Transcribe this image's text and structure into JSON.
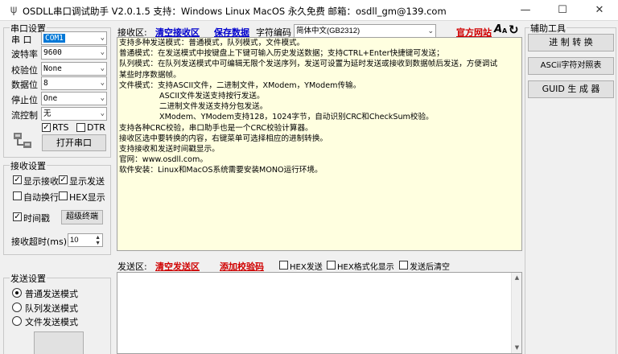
{
  "window": {
    "title": "OSDLL串口调试助手 V2.0.1.5 支持：Windows  Linux  MacOS   永久免费   邮箱：osdll_gm@139.com",
    "minimize": "—",
    "maximize": "☐",
    "close": "✕"
  },
  "serial_settings": {
    "title": "串口设置",
    "port_label": "串  口",
    "port_value": "COM1",
    "baud_label": "波特率",
    "baud_value": "9600",
    "parity_label": "校验位",
    "parity_value": "None",
    "databits_label": "数据位",
    "databits_value": "8",
    "stopbits_label": "停止位",
    "stopbits_value": "One",
    "flow_label": "流控制",
    "flow_value": "无",
    "rts_label": "RTS",
    "rts_checked": true,
    "dtr_label": "DTR",
    "dtr_checked": false,
    "open_button": "打开串口"
  },
  "receive_settings": {
    "title": "接收设置",
    "show_recv_label": "显示接收",
    "show_recv_checked": true,
    "show_send_label": "显示发送",
    "show_send_checked": true,
    "auto_wrap_label": "自动换行",
    "auto_wrap_checked": false,
    "hex_show_label": "HEX显示",
    "hex_show_checked": false,
    "timestamp_label": "时间戳",
    "timestamp_checked": true,
    "super_terminal_button": "超级终端",
    "timeout_label": "接收超时(ms):",
    "timeout_value": "10"
  },
  "send_settings": {
    "title": "发送设置",
    "mode_normal": "普通发送模式",
    "mode_queue": "队列发送模式",
    "mode_file": "文件发送模式",
    "selected": "normal"
  },
  "receive_area": {
    "label": "接收区:",
    "clear_link": "清空接收区",
    "save_link": "保存数据",
    "encoding_label": "字符编码",
    "encoding_value": "简体中文(GB2312)",
    "website_link": "官方网站",
    "lines": [
      "支持多种发送模式：普通模式，队列模式，文件模式。",
      "普通模式：在发送模式中按键盘上下键可输入历史发送数据；支持CTRL+Enter快捷键可发送；",
      "队列模式：在队列发送模式中可编辑无限个发送序列，发送可设置为延时发送或接收到数据帧后发送，方便调试",
      "某些时序数据帧。",
      "文件模式：支持ASCII文件，二进制文件，XModem，YModem传输。",
      "          ASCII文件发送支持按行发送。",
      "          二进制文件发送支持分包发送。",
      "          XModem、YModem支持128，1024字节，自动识别CRC和CheckSum校验。",
      "支持各种CRC校验，串口助手也是一个CRC校验计算器。",
      "接收区选中要转换的内容，右键菜单可选择相应的进制转换。",
      "支持接收和发送时间戳显示。",
      "官网：www.osdll.com。",
      "软件安装：Linux和MacOS系统需要安装MONO运行环境。"
    ]
  },
  "send_area": {
    "label": "发送区:",
    "clear_link": "清空发送区",
    "add_checksum_link": "添加校验码",
    "hex_send_label": "HEX发送",
    "hex_send_checked": false,
    "hex_format_label": "HEX格式化显示",
    "hex_format_checked": false,
    "clear_after_send_label": "发送后清空",
    "clear_after_send_checked": false
  },
  "aux_tools": {
    "title": "辅助工具",
    "buttons": [
      "进 制 转 换",
      "ASCii字符对照表",
      "GUID 生 成 器"
    ]
  }
}
